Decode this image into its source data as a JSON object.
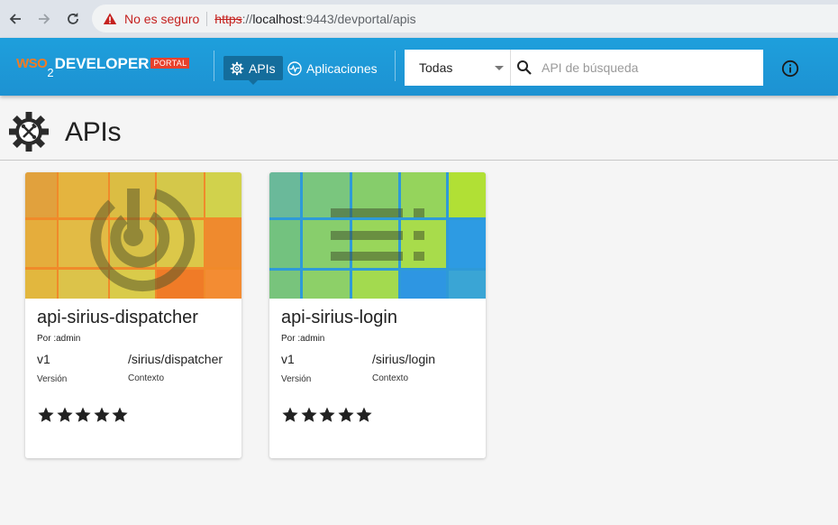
{
  "browser": {
    "security_label": "No es seguro",
    "url_scheme": "https",
    "url_host": "localhost",
    "url_rest": ":9443/devportal/apis"
  },
  "header": {
    "logo": {
      "wso": "WSO",
      "two": "2",
      "developer": "DEVELOPER",
      "portal": "PORTAL"
    },
    "tabs": [
      {
        "label": "APIs",
        "icon": "gear-icon",
        "active": true
      },
      {
        "label": "Aplicaciones",
        "icon": "activity-icon",
        "active": false
      }
    ],
    "search": {
      "scope_value": "Todas",
      "placeholder": "API de búsqueda",
      "value": ""
    },
    "info_icon": "info-icon"
  },
  "page": {
    "title": "APIs",
    "title_icon": "api-gear-icon"
  },
  "apis": [
    {
      "name": "api-sirius-dispatcher",
      "by": "Por :admin",
      "version": "v1",
      "version_label": "Versión",
      "context": "/sirius/dispatcher",
      "context_label": "Contexto",
      "rating": 5,
      "thumbnail_icon": "power-icon",
      "thumbnail_colors": [
        "#e4a93a",
        "#f18a2d",
        "#d6d044",
        "#f07d25"
      ]
    },
    {
      "name": "api-sirius-login",
      "by": "Por :admin",
      "version": "v1",
      "version_label": "Versión",
      "context": "/sirius/login",
      "context_label": "Contexto",
      "rating": 5,
      "thumbnail_icon": "list-icon",
      "thumbnail_colors": [
        "#6cc38a",
        "#2f9de0",
        "#a9dd47",
        "#3aa0d5"
      ]
    }
  ],
  "colors": {
    "header_bg": "#1e9fdc",
    "active_tab_bg": "#146d9c",
    "accent_orange": "#f47b20",
    "portal_badge": "#e8412c"
  }
}
